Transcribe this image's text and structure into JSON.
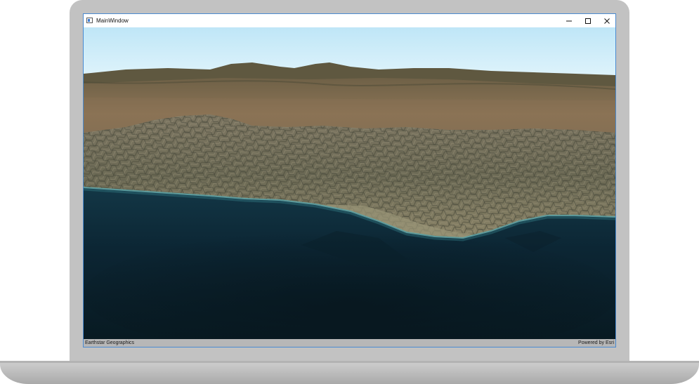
{
  "window": {
    "title": "MainWindow",
    "icon": "app-window-icon",
    "controls": {
      "minimize_icon": "minimize-icon",
      "maximize_icon": "maximize-icon",
      "close_icon": "close-icon"
    }
  },
  "scene": {
    "description_type": "3d-satellite-terrain-view"
  },
  "attribution": {
    "left": "Earthstar Geographics",
    "right": "Powered by Esri"
  },
  "colors": {
    "window_border": "#4a8ad0",
    "laptop_body": "#c2c2c2",
    "sky": "#cfeefa",
    "ocean": "#0c2230"
  }
}
